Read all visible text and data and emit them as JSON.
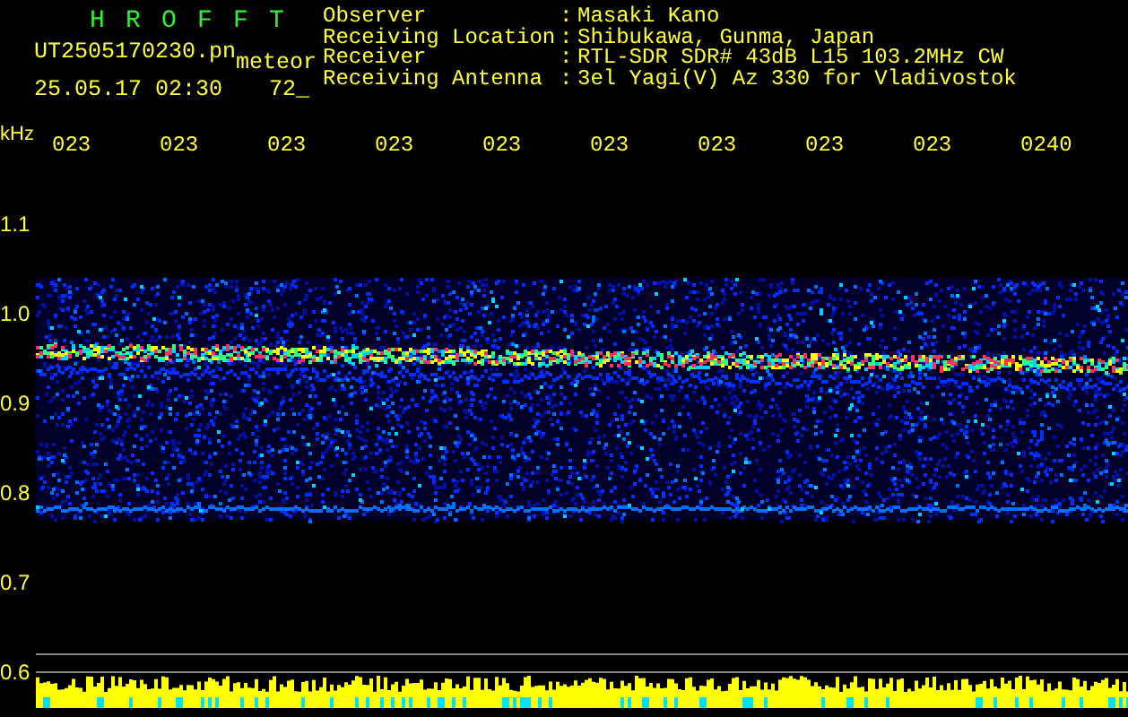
{
  "header": {
    "title_letters": [
      "H",
      "R",
      "O",
      "F",
      "F",
      "T"
    ],
    "file_name": "UT2505170230.pn",
    "file_suffix": "meteor",
    "timestamp": "25.05.17 02:30",
    "counter": "72_"
  },
  "station_info": [
    {
      "label": "Observer",
      "separator": ":",
      "value": "Masaki Kano"
    },
    {
      "label": "Receiving Location",
      "separator": ":",
      "value": "Shibukawa, Gunma, Japan"
    },
    {
      "label": "Receiver",
      "separator": ":",
      "value": "RTL-SDR SDR# 43dB L15 103.2MHz CW"
    },
    {
      "label": "Receiving Antenna",
      "separator": ":",
      "value": "3el Yagi(V) Az 330 for Vladivostok"
    }
  ],
  "time_axis": {
    "unit": "kHz",
    "labels": [
      "023",
      "023",
      "023",
      "023",
      "023",
      "023",
      "023",
      "023",
      "023",
      "0240"
    ]
  },
  "frequency_axis": {
    "labels": [
      "1.1",
      "1.0",
      "0.9",
      "0.8",
      "0.7",
      "0.6"
    ]
  }
}
